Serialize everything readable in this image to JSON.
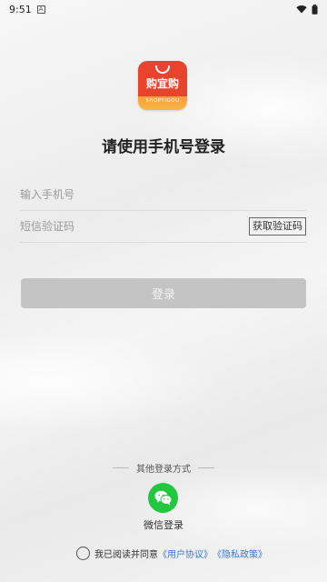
{
  "status_bar": {
    "time": "9:51",
    "notification_icon": "A"
  },
  "app": {
    "logo_text": "购宜购",
    "logo_subtext": "SHOPYIGOU",
    "logo_colors": {
      "top": "#e8432d",
      "bottom": "#f7b548"
    }
  },
  "title": "请使用手机号登录",
  "form": {
    "phone_placeholder": "输入手机号",
    "code_placeholder": "短信验证码",
    "get_code_label": "获取验证码",
    "login_label": "登录"
  },
  "other_login": {
    "title": "其他登录方式",
    "wechat_label": "微信登录",
    "wechat_color": "#21c73f"
  },
  "agreement": {
    "prefix": "我已阅读并同意",
    "user_agreement": "《用户协议》",
    "privacy_policy": "《隐私政策》",
    "link_color": "#3a78d6"
  }
}
